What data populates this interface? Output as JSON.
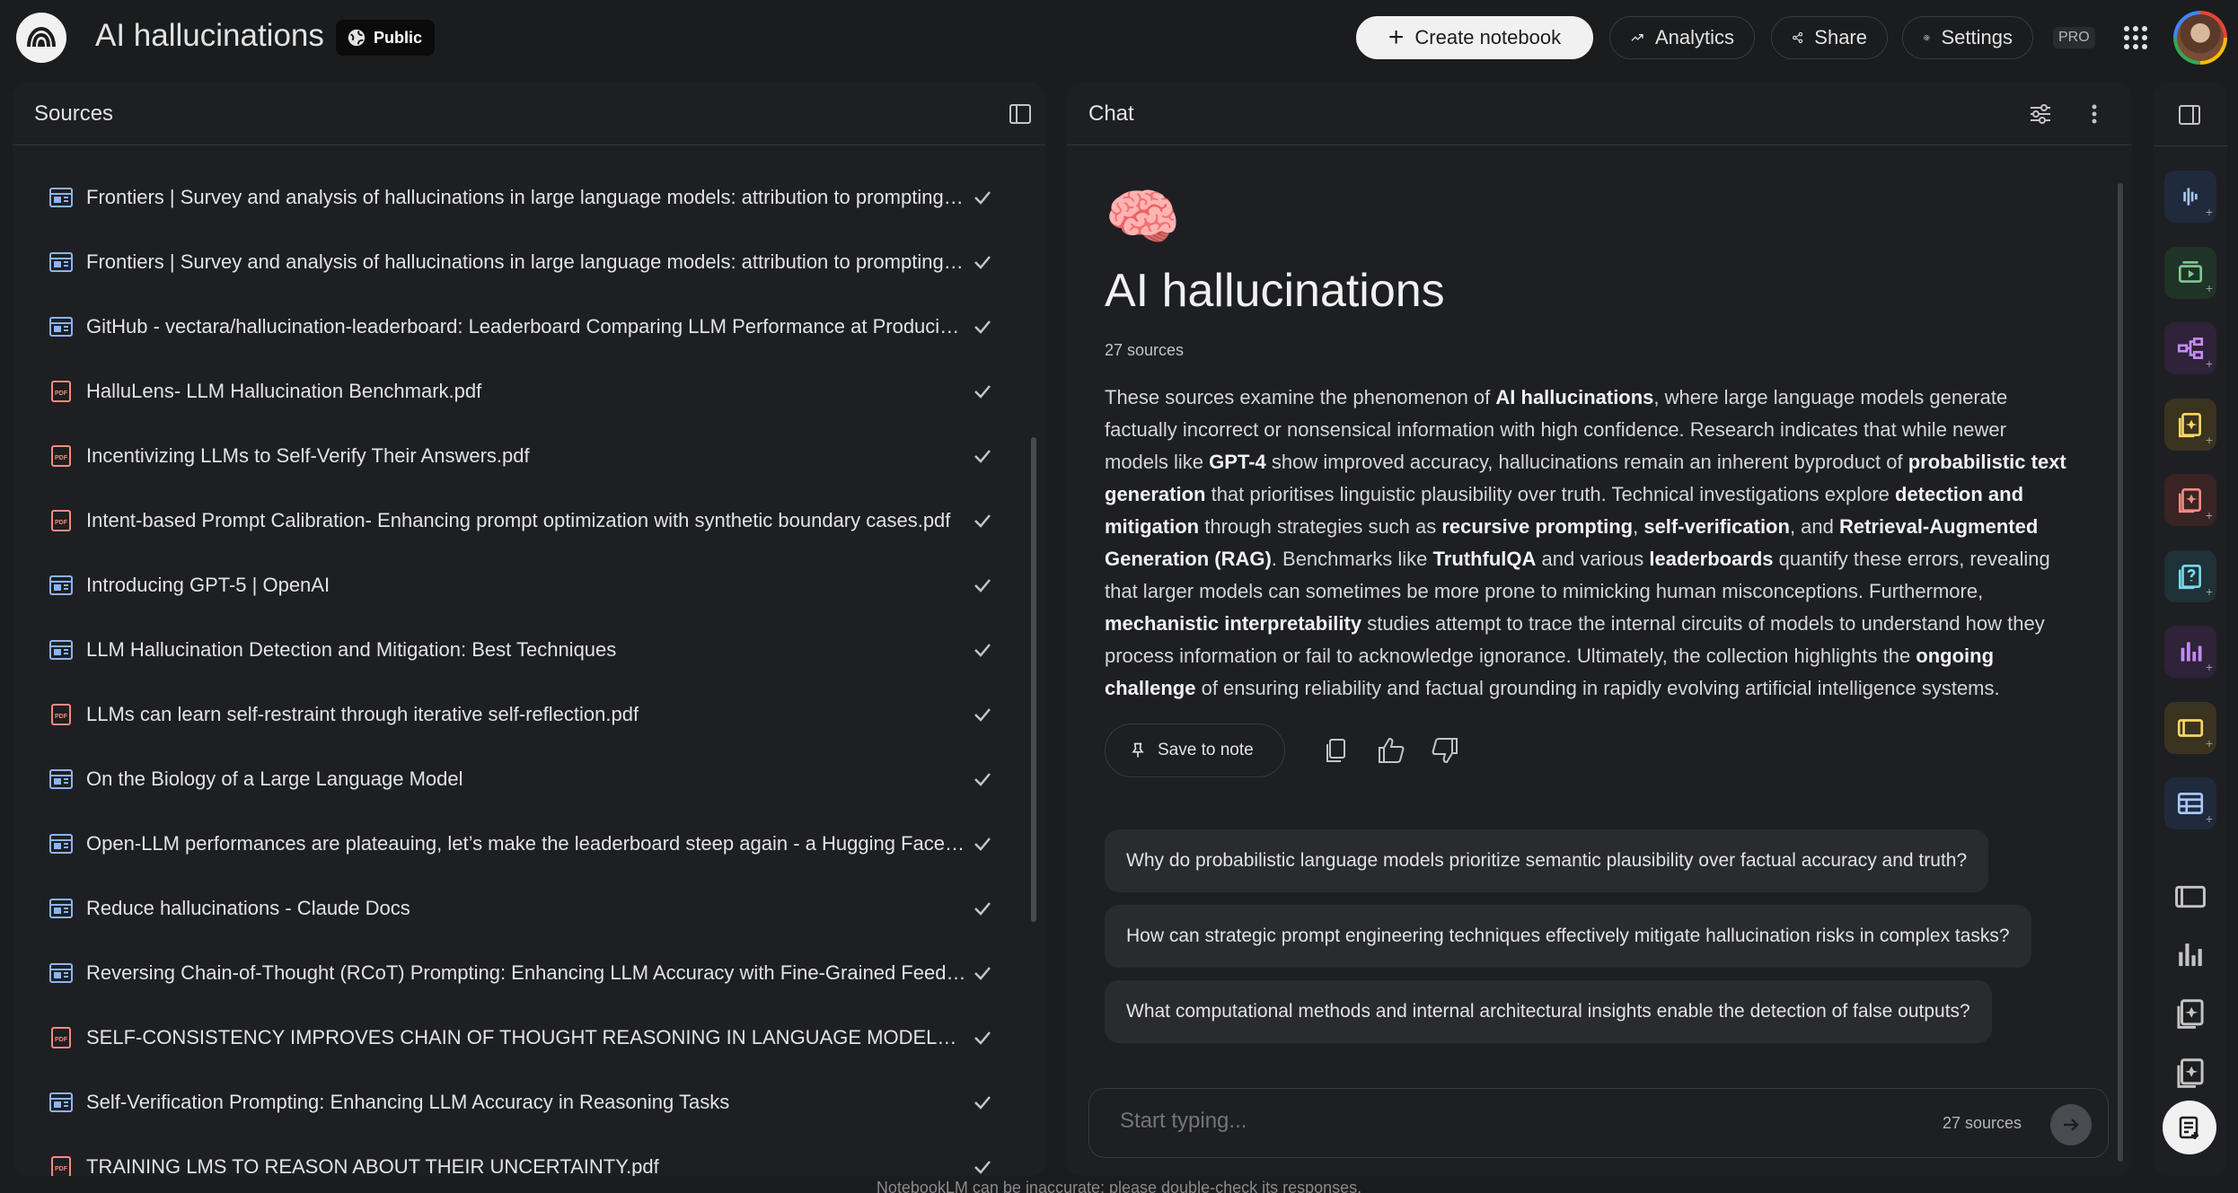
{
  "header": {
    "title": "AI hallucinations",
    "public_label": "Public",
    "create_label": "Create notebook",
    "analytics_label": "Analytics",
    "share_label": "Share",
    "settings_label": "Settings",
    "pro_label": "PRO"
  },
  "sources": {
    "heading": "Sources",
    "items": [
      {
        "type": "web",
        "title": "Frontiers | Survey and analysis of hallucinations in large language models: attribution to prompting s...",
        "checked": true
      },
      {
        "type": "web",
        "title": "Frontiers | Survey and analysis of hallucinations in large language models: attribution to prompting s...",
        "checked": true
      },
      {
        "type": "web",
        "title": "GitHub - vectara/hallucination-leaderboard: Leaderboard Comparing LLM Performance at Producin...",
        "checked": true
      },
      {
        "type": "pdf",
        "title": "HalluLens- LLM Hallucination Benchmark.pdf",
        "checked": true
      },
      {
        "type": "pdf",
        "title": "Incentivizing LLMs to Self-Verify Their Answers.pdf",
        "checked": true
      },
      {
        "type": "pdf",
        "title": "Intent-based Prompt Calibration- Enhancing prompt optimization with synthetic boundary cases.pdf",
        "checked": true
      },
      {
        "type": "web",
        "title": "Introducing GPT-5 | OpenAI",
        "checked": true
      },
      {
        "type": "web",
        "title": "LLM Hallucination Detection and Mitigation: Best Techniques",
        "checked": true
      },
      {
        "type": "pdf",
        "title": "LLMs can learn self-restraint through iterative self-reflection.pdf",
        "checked": true
      },
      {
        "type": "web",
        "title": "On the Biology of a Large Language Model",
        "checked": true
      },
      {
        "type": "web",
        "title": "Open-LLM performances are plateauing, let’s make the leaderboard steep again - a Hugging Face S...",
        "checked": true
      },
      {
        "type": "web",
        "title": "Reduce hallucinations - Claude Docs",
        "checked": true
      },
      {
        "type": "web",
        "title": "Reversing Chain-of-Thought (RCoT) Prompting: Enhancing LLM Accuracy with Fine-Grained Feedba...",
        "checked": true
      },
      {
        "type": "pdf",
        "title": "SELF-CONSISTENCY IMPROVES CHAIN OF THOUGHT REASONING IN LANGUAGE MODELS.pdf",
        "checked": true
      },
      {
        "type": "web",
        "title": "Self-Verification Prompting: Enhancing LLM Accuracy in Reasoning Tasks",
        "checked": true
      },
      {
        "type": "pdf",
        "title": "TRAINING LMS TO REASON ABOUT THEIR UNCERTAINTY.pdf",
        "checked": true
      }
    ]
  },
  "chat": {
    "heading": "Chat",
    "emoji": "🧠",
    "notebook_title": "AI hallucinations",
    "source_count": "27 sources",
    "summary": [
      {
        "t": "These sources examine the phenomenon of ",
        "b": false
      },
      {
        "t": "AI hallucinations",
        "b": true
      },
      {
        "t": ", where large language models generate factually incorrect or nonsensical information with high confidence. Research indicates that while newer models like ",
        "b": false
      },
      {
        "t": "GPT-4",
        "b": true
      },
      {
        "t": " show improved accuracy, hallucinations remain an inherent byproduct of ",
        "b": false
      },
      {
        "t": "probabilistic text generation",
        "b": true
      },
      {
        "t": " that prioritises linguistic plausibility over truth. Technical investigations explore ",
        "b": false
      },
      {
        "t": "detection and mitigation",
        "b": true
      },
      {
        "t": " through strategies such as ",
        "b": false
      },
      {
        "t": "recursive prompting",
        "b": true
      },
      {
        "t": ", ",
        "b": false
      },
      {
        "t": "self-verification",
        "b": true
      },
      {
        "t": ", and ",
        "b": false
      },
      {
        "t": "Retrieval-Augmented Generation (RAG)",
        "b": true
      },
      {
        "t": ". Benchmarks like ",
        "b": false
      },
      {
        "t": "TruthfulQA",
        "b": true
      },
      {
        "t": " and various ",
        "b": false
      },
      {
        "t": "leaderboards",
        "b": true
      },
      {
        "t": " quantify these errors, revealing that larger models can sometimes be more prone to mimicking human misconceptions. Furthermore, ",
        "b": false
      },
      {
        "t": "mechanistic interpretability",
        "b": true
      },
      {
        "t": " studies attempt to trace the internal circuits of models to understand how they process information or fail to acknowledge ignorance. Ultimately, the collection highlights the ",
        "b": false
      },
      {
        "t": "ongoing challenge",
        "b": true
      },
      {
        "t": " of ensuring reliability and factual grounding in rapidly evolving artificial intelligence systems.",
        "b": false
      }
    ],
    "save_note_label": "Save to note",
    "suggestions": [
      "Why do probabilistic language models prioritize semantic plausibility over factual accuracy and truth?",
      "How can strategic prompt engineering techniques effectively mitigate hallucination risks in complex tasks?",
      "What computational methods and internal architectural insights enable the detection of false outputs?"
    ],
    "input_placeholder": "Start typing...",
    "input_source_count": "27 sources"
  },
  "studio": {
    "tools": [
      {
        "icon": "audio-overview-icon",
        "color": "#a8c7fa",
        "bg": "#1f2a3d"
      },
      {
        "icon": "video-overview-icon",
        "color": "#81c995",
        "bg": "#1f3326"
      },
      {
        "icon": "mind-map-icon",
        "color": "#c58af9",
        "bg": "#2e2338"
      },
      {
        "icon": "reports-icon",
        "color": "#fdd663",
        "bg": "#3a3320"
      },
      {
        "icon": "flashcards-icon",
        "color": "#f28b82",
        "bg": "#3a2323"
      },
      {
        "icon": "quiz-icon",
        "color": "#78d9ec",
        "bg": "#1e3238"
      },
      {
        "icon": "infographic-icon",
        "color": "#c58af9",
        "bg": "#2e2338"
      },
      {
        "icon": "slide-deck-icon",
        "color": "#fdd663",
        "bg": "#3a3320"
      },
      {
        "icon": "data-table-icon",
        "color": "#a8c7fa",
        "bg": "#1f2a3d"
      }
    ],
    "outputs": [
      "slides-output-icon",
      "chart-output-icon",
      "report-output-icon",
      "note-output-icon"
    ]
  },
  "footer": {
    "disclaimer": "NotebookLM can be inaccurate; please double-check its responses."
  }
}
